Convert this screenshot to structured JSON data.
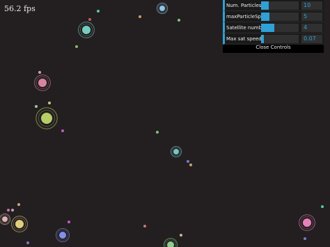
{
  "fps": "56.2 fps",
  "controls": [
    {
      "label": "Num. Particles",
      "value": "10",
      "fill": 0.2
    },
    {
      "label": "maxParticleSpeed",
      "value": "5",
      "fill": 0.22
    },
    {
      "label": "Satellite number",
      "value": "4",
      "fill": 0.35
    },
    {
      "label": "Max sat speed",
      "value": "0.07",
      "fill": 0.07
    }
  ],
  "close_label": "Close Controls",
  "colors": {
    "background": "#231f20",
    "accent": "#2fa1d6"
  },
  "particles": [
    {
      "color": "#80e0d0",
      "r": 6
    },
    {
      "color": "#9ad8ff",
      "r": 4
    },
    {
      "color": "#f08fb0",
      "r": 6
    },
    {
      "color": "#c8e070",
      "r": 8
    },
    {
      "color": "#f6e08a",
      "r": 6
    },
    {
      "color": "#f2c4c4",
      "r": 4
    },
    {
      "color": "#8c9cff",
      "r": 5
    },
    {
      "color": "#ff8cc8",
      "r": 6
    },
    {
      "color": "#9be09b",
      "r": 5
    },
    {
      "color": "#80d8d8",
      "r": 4
    }
  ]
}
